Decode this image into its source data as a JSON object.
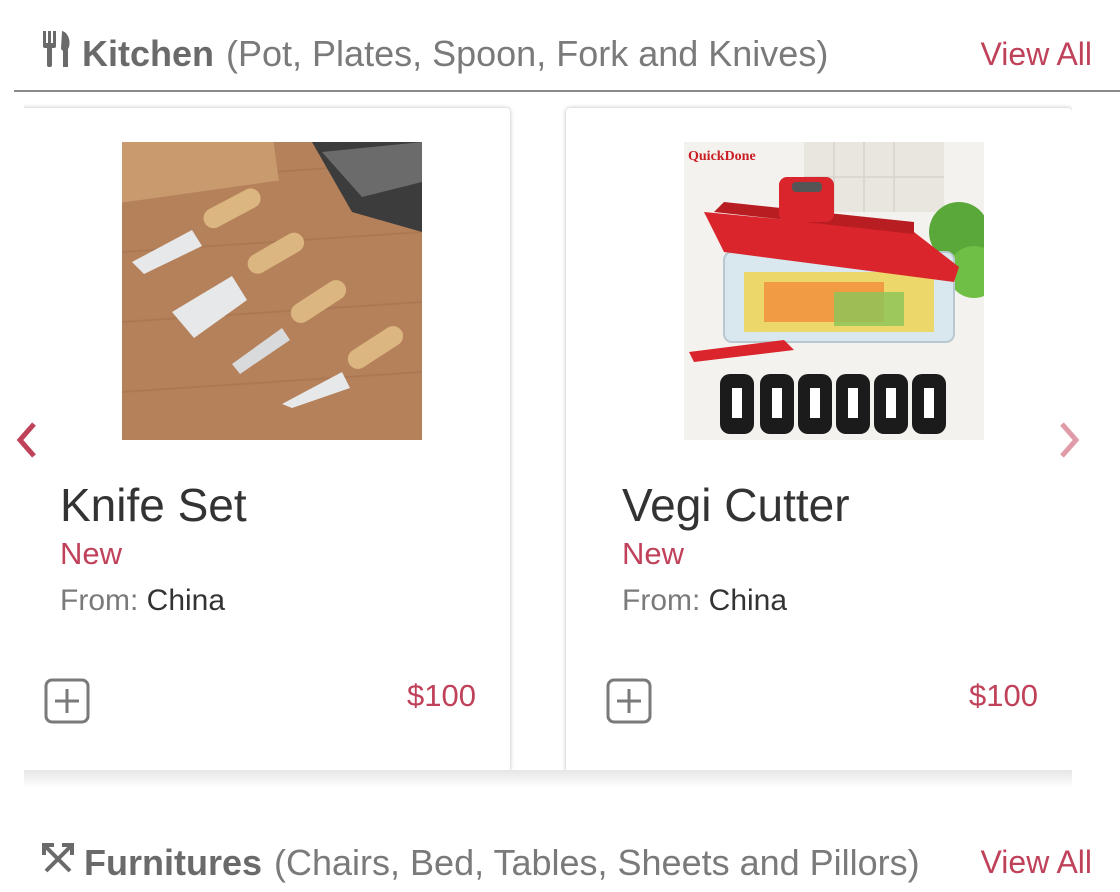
{
  "kitchen": {
    "title": "Kitchen",
    "subtitle": "(Pot, Plates, Spoon, Fork and Knives)",
    "view_all": "View All",
    "icon": "utensils-icon"
  },
  "carousel": {
    "prev_icon": "chevron-left-icon",
    "next_icon": "chevron-right-icon",
    "products": [
      {
        "name": "Knife Set",
        "condition": "New",
        "from_label": "From:",
        "origin": "China",
        "price": "$100"
      },
      {
        "name": "Vegi Cutter",
        "condition": "New",
        "from_label": "From:",
        "origin": "China",
        "price": "$100"
      }
    ]
  },
  "furnitures": {
    "title": "Furnitures",
    "subtitle": "(Chairs, Bed, Tables, Sheets and Pillors)",
    "view_all": "View All",
    "icon": "expand-arrows-icon"
  },
  "colors": {
    "accent": "#c0425a",
    "muted": "#7a7a7a",
    "text": "#333333"
  }
}
